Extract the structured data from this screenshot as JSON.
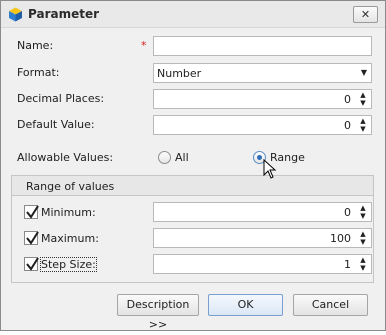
{
  "window": {
    "title": "Parameter",
    "close_label": "✕"
  },
  "form": {
    "name_label": "Name:",
    "required_mark": "*",
    "name_value": "",
    "format_label": "Format:",
    "format_value": "Number",
    "decimal_label": "Decimal Places:",
    "decimal_value": "0",
    "default_label": "Default Value:",
    "default_value": "0",
    "allowable_label": "Allowable Values:",
    "allowable_options": [
      {
        "label": "All",
        "selected": false
      },
      {
        "label": "Range",
        "selected": true
      }
    ]
  },
  "range": {
    "title": "Range of values",
    "minimum": {
      "label": "Minimum:",
      "checked": true,
      "value": "0"
    },
    "maximum": {
      "label": "Maximum:",
      "checked": true,
      "value": "100"
    },
    "step": {
      "label": "Step Size:",
      "checked": true,
      "value": "1"
    }
  },
  "buttons": {
    "description": "Description >>",
    "ok": "OK",
    "cancel": "Cancel"
  },
  "icons": {
    "app": "app-cube-icon",
    "close": "close-icon",
    "spin_up": "▲",
    "spin_down": "▼",
    "dropdown": "▼"
  },
  "colors": {
    "required": "#d02020",
    "radio_selected": "#2f6fb7",
    "default_button_border": "#7a9fd1"
  }
}
